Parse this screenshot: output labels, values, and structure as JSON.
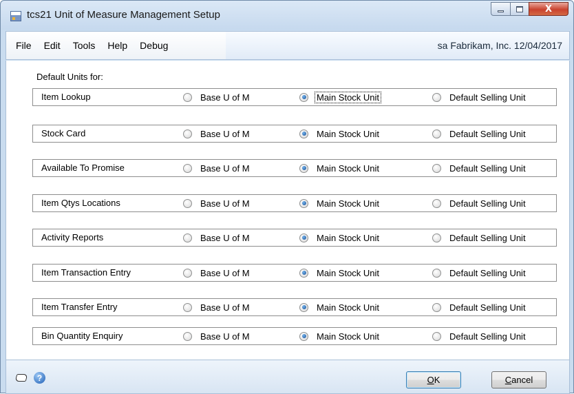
{
  "window": {
    "title": "tcs21 Unit of Measure Management Setup",
    "close_glyph": "X"
  },
  "menu": {
    "items": [
      "File",
      "Edit",
      "Tools",
      "Help",
      "Debug"
    ],
    "status": "sa  Fabrikam, Inc. 12/04/2017"
  },
  "section_label": "Default Units for:",
  "options": [
    "Base U of M",
    "Main Stock Unit",
    "Default Selling Unit"
  ],
  "rows": [
    {
      "label": "Item Lookup",
      "selected": 1
    },
    {
      "label": "Stock Card",
      "selected": 1
    },
    {
      "label": "Available To Promise",
      "selected": 1
    },
    {
      "label": "Item Qtys Locations",
      "selected": 1
    },
    {
      "label": "Activity Reports",
      "selected": 1
    },
    {
      "label": "Item Transaction Entry",
      "selected": 1
    },
    {
      "label": "Item Transfer Entry",
      "selected": 1
    },
    {
      "label": "Bin Quantity Enquiry",
      "selected": 1
    }
  ],
  "footer": {
    "ok": {
      "accel": "O",
      "rest": "K"
    },
    "cancel": {
      "accel": "C",
      "rest": "ancel"
    },
    "help_glyph": "?"
  },
  "icons": [
    "app-icon",
    "minimize-icon",
    "maximize-icon",
    "close-icon",
    "note-icon",
    "help-icon"
  ]
}
